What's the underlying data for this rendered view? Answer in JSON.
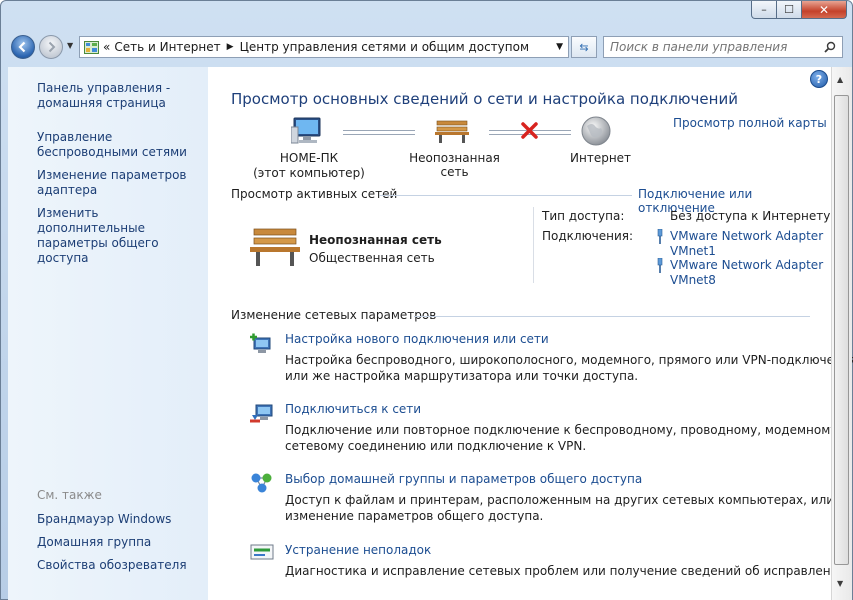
{
  "window": {
    "close_glyph": "✕",
    "maximize_glyph": "☐",
    "minimize_glyph": "–"
  },
  "address": {
    "overflow": "«",
    "crumbs": [
      "Сеть и Интернет",
      "Центр управления сетями и общим доступом"
    ],
    "search_placeholder": "Поиск в панели управления"
  },
  "sidebar": {
    "links": [
      "Панель управления - домашняя страница",
      "Управление беспроводными сетями",
      "Изменение параметров адаптера",
      "Изменить дополнительные параметры общего доступа"
    ],
    "see_also_label": "См. также",
    "see_also": [
      "Брандмауэр Windows",
      "Домашняя группа",
      "Свойства обозревателя"
    ]
  },
  "main": {
    "heading": "Просмотр основных сведений о сети и настройка подключений",
    "full_map_link": "Просмотр полной карты",
    "map": {
      "computer_name": "HOME-ПК",
      "computer_sub": "(этот компьютер)",
      "network_name": "Неопознанная сеть",
      "internet_label": "Интернет"
    },
    "active_networks": {
      "header": "Просмотр активных сетей",
      "connect_link": "Подключение или отключение",
      "network_title": "Неопознанная сеть",
      "network_type": "Общественная сеть",
      "access_type_label": "Тип доступа:",
      "access_type_value": "Без доступа к Интернету",
      "connections_label": "Подключения:",
      "connections": [
        {
          "line1": "VMware Network Adapter",
          "line2": "VMnet1"
        },
        {
          "line1": "VMware Network Adapter",
          "line2": "VMnet8"
        }
      ]
    },
    "change_settings": {
      "header": "Изменение сетевых параметров",
      "tasks": [
        {
          "title": "Настройка нового подключения или сети",
          "desc1": "Настройка беспроводного, широкополосного, модемного, прямого или VPN-подключения",
          "desc2": "или же настройка маршрутизатора или точки доступа."
        },
        {
          "title": "Подключиться к сети",
          "desc1": "Подключение или повторное подключение к беспроводному, проводному, модемному",
          "desc2": "сетевому соединению или подключение к VPN."
        },
        {
          "title": "Выбор домашней группы и параметров общего доступа",
          "desc1": "Доступ к файлам и принтерам, расположенным на других сетевых компьютерах, или",
          "desc2": "изменение параметров общего доступа."
        },
        {
          "title": "Устранение неполадок",
          "desc1": "Диагностика и исправление сетевых проблем или получение сведений об исправлении.",
          "desc2": ""
        }
      ]
    }
  }
}
